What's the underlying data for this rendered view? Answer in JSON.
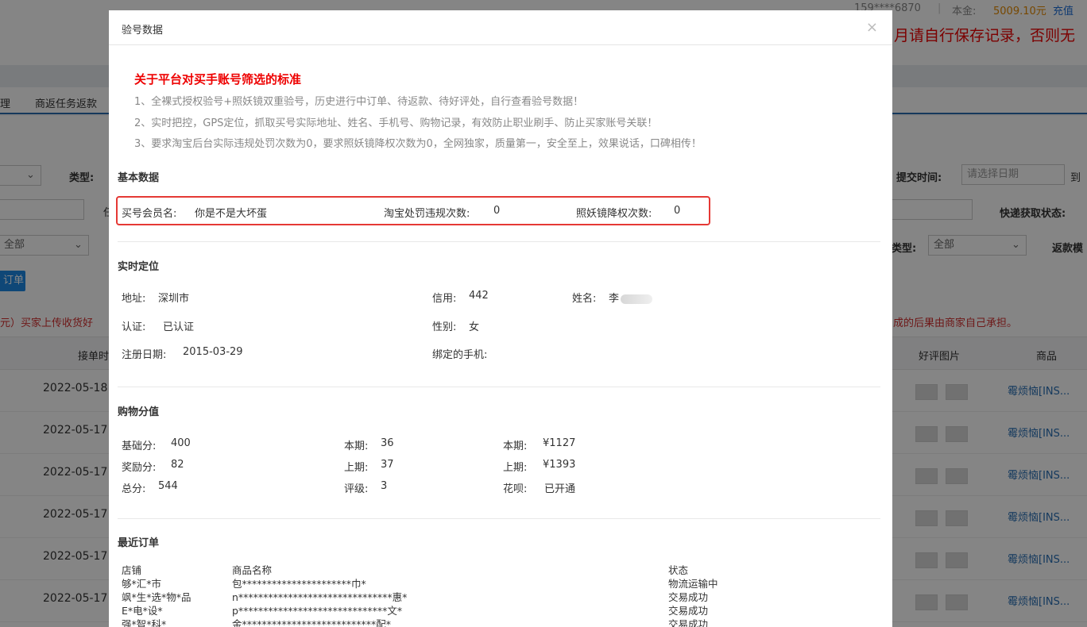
{
  "background": {
    "account_masked": "159****6870",
    "balance_label": "本金:",
    "balance_value": "5009.10元",
    "recharge_link": "充值",
    "notice_fragment": "月请自行保存记录，否则无",
    "nav_fragment_1": "理",
    "nav_fragment_2": "商返任务返款",
    "type_label": "类型:",
    "submit_time_label": "提交时间:",
    "date_placeholder": "请选择日期",
    "date_to": "到",
    "express_status_label": "快递获取状态:",
    "select_all_left": "全部",
    "type_label_right": "类型:",
    "select_all_right": "全部",
    "refund_mode_label": "返款模",
    "order_button_fragment": "订单",
    "warning_fragment_left": "元）买家上传收货好",
    "warning_fragment_right": "成的后果由商家自己承担。",
    "col_accept_time": "接单时",
    "col_review_images": "好评图片",
    "col_product": "商品",
    "rows": [
      {
        "date": "2022-05-18",
        "product": "霉烦恼[INS..."
      },
      {
        "date": "2022-05-17",
        "product": "霉烦恼[INS..."
      },
      {
        "date": "2022-05-17",
        "product": "霉烦恼[INS..."
      },
      {
        "date": "2022-05-17",
        "product": "霉烦恼[INS..."
      },
      {
        "date": "2022-05-17",
        "product": "霉烦恼[INS..."
      },
      {
        "date": "2022-05-17",
        "product": "霉烦恼[INS..."
      }
    ]
  },
  "modal": {
    "title": "验号数据",
    "close_symbol": "×",
    "standard_title": "关于平台对买手账号筛选的标准",
    "standard_lines": [
      "1、全裸式授权验号+照妖镜双重验号，历史进行中订单、待返款、待好评处，自行查看验号数据！",
      "2、实时把控，GPS定位，抓取买号实际地址、姓名、手机号、购物记录，有效防止职业刷手、防止买家账号关联！",
      "3、要求淘宝后台实际违规处罚次数为0，要求照妖镜降权次数为0，全网独家，质量第一，安全至上，效果说话，口碑相传！"
    ],
    "basic": {
      "title": "基本数据",
      "member_label": "买号会员名:",
      "member_value": "你是不是大坏蛋",
      "violation_label": "淘宝处罚违规次数:",
      "violation_value": "0",
      "downgrade_label": "照妖镜降权次数:",
      "downgrade_value": "0"
    },
    "location": {
      "title": "实时定位",
      "address_label": "地址:",
      "address_value": "深圳市",
      "credit_label": "信用:",
      "credit_value": "442",
      "name_label": "姓名:",
      "name_value": "李",
      "verify_label": "认证:",
      "verify_value": "已认证",
      "gender_label": "性别:",
      "gender_value": "女",
      "register_label": "注册日期:",
      "register_value": "2015-03-29",
      "phone_label": "绑定的手机:",
      "phone_value": ""
    },
    "shopping": {
      "title": "购物分值",
      "base_label": "基础分:",
      "base_value": "400",
      "reward_label": "奖励分:",
      "reward_value": "82",
      "total_label": "总分:",
      "total_value": "544",
      "cur_label": "本期:",
      "cur_value": "36",
      "prev_label": "上期:",
      "prev_value": "37",
      "grade_label": "评级:",
      "grade_value": "3",
      "cur_amount_label": "本期:",
      "cur_amount_value": "¥1127",
      "prev_amount_label": "上期:",
      "prev_amount_value": "¥1393",
      "huabei_label": "花呗:",
      "huabei_value": "已开通"
    },
    "orders": {
      "title": "最近订单",
      "col_shop": "店铺",
      "col_product": "商品名称",
      "col_status": "状态",
      "rows": [
        {
          "shop": "够*汇*市",
          "product": "包**********************巾*",
          "status": "物流运输中"
        },
        {
          "shop": "飒*生*选*物*品",
          "product": "n*******************************惠*",
          "status": "交易成功"
        },
        {
          "shop": "E*电*设*",
          "product": "p******************************文*",
          "status": "交易成功"
        },
        {
          "shop": "强*智*科*",
          "product": "金***************************配*",
          "status": "交易成功"
        }
      ]
    }
  }
}
